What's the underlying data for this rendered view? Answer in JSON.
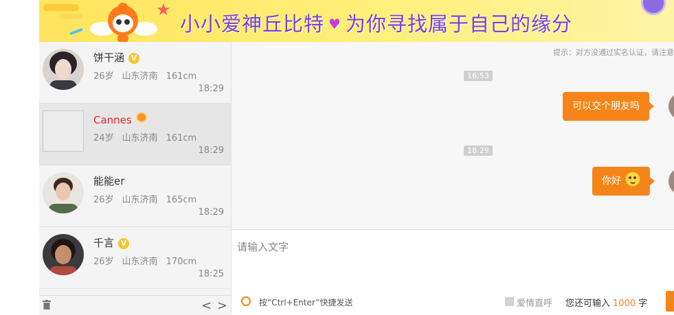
{
  "banner": {
    "title_part1": "小小爱神丘比特",
    "heart": "♥",
    "title_part2": "为你寻找属于自己的缘分"
  },
  "contacts": [
    {
      "name": "饼干涵",
      "badge": "V",
      "age": "26岁",
      "location": "山东济南",
      "height": "161cm",
      "time": "18:29",
      "active": false
    },
    {
      "name": "Cannes",
      "badge": "medal",
      "age": "24岁",
      "location": "山东济南",
      "height": "161cm",
      "time": "18:29",
      "active": true
    },
    {
      "name": "能能er",
      "badge": "",
      "age": "26岁",
      "location": "山东济南",
      "height": "165cm",
      "time": "18:29",
      "active": false
    },
    {
      "name": "千言",
      "badge": "V",
      "age": "26岁",
      "location": "山东济南",
      "height": "170cm",
      "time": "18:25",
      "active": false
    }
  ],
  "sidebar_footer": {
    "prev_glyph": "<",
    "next_glyph": ">"
  },
  "chat": {
    "tip": "提示：对方没通过实名认证，请注意",
    "messages": [
      {
        "timestamp": "16:53",
        "text": "可以交个朋友吗",
        "emoji": false
      },
      {
        "timestamp": "18:29",
        "text": "你好",
        "emoji": true
      }
    ]
  },
  "composer": {
    "placeholder": "请输入文字",
    "hint": "按“Ctrl+Enter”快捷发送",
    "checkbox_label": "爱情直呼",
    "remaining_prefix": "您还可输入",
    "remaining_count": "1000",
    "remaining_suffix": "字"
  },
  "colors": {
    "accent": "#f58518",
    "active_name": "#e02a2a",
    "badge": "#f6c531"
  }
}
